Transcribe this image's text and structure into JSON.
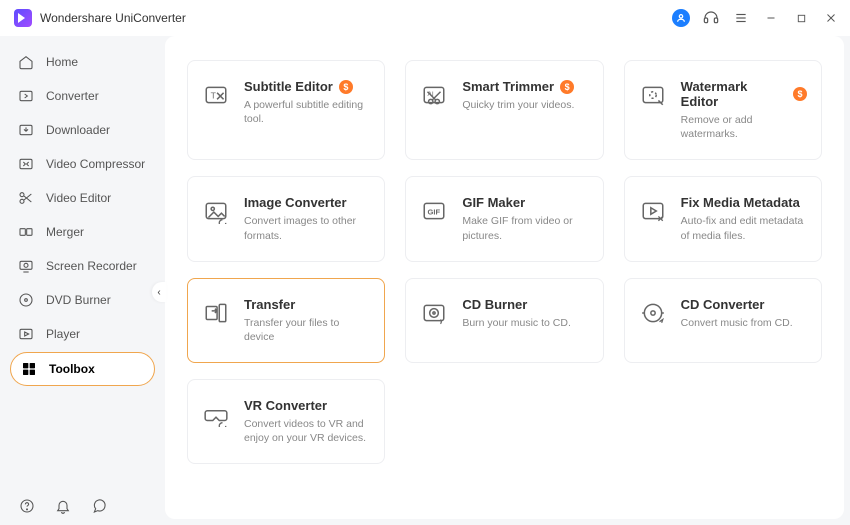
{
  "app": {
    "title": "Wondershare UniConverter"
  },
  "sidebar": {
    "items": [
      {
        "label": "Home"
      },
      {
        "label": "Converter"
      },
      {
        "label": "Downloader"
      },
      {
        "label": "Video Compressor"
      },
      {
        "label": "Video Editor"
      },
      {
        "label": "Merger"
      },
      {
        "label": "Screen Recorder"
      },
      {
        "label": "DVD Burner"
      },
      {
        "label": "Player"
      },
      {
        "label": "Toolbox"
      }
    ],
    "active_index": 9
  },
  "tools": [
    {
      "title": "Subtitle Editor",
      "desc": "A powerful subtitle editing tool.",
      "premium": true,
      "icon": "subtitle"
    },
    {
      "title": "Smart Trimmer",
      "desc": "Quicky trim your videos.",
      "premium": true,
      "icon": "trimmer"
    },
    {
      "title": "Watermark Editor",
      "desc": "Remove or add watermarks.",
      "premium": true,
      "icon": "watermark"
    },
    {
      "title": "Image Converter",
      "desc": "Convert images to other formats.",
      "premium": false,
      "icon": "image"
    },
    {
      "title": "GIF Maker",
      "desc": "Make GIF from video or pictures.",
      "premium": false,
      "icon": "gif"
    },
    {
      "title": "Fix Media Metadata",
      "desc": "Auto-fix and edit metadata of media files.",
      "premium": false,
      "icon": "metadata"
    },
    {
      "title": "Transfer",
      "desc": "Transfer your files to device",
      "premium": false,
      "icon": "transfer",
      "highlight": true
    },
    {
      "title": "CD Burner",
      "desc": "Burn your music to CD.",
      "premium": false,
      "icon": "cdburn"
    },
    {
      "title": "CD Converter",
      "desc": "Convert music from CD.",
      "premium": false,
      "icon": "cdconvert"
    },
    {
      "title": "VR Converter",
      "desc": "Convert videos to VR and enjoy on your VR devices.",
      "premium": false,
      "icon": "vr"
    }
  ]
}
